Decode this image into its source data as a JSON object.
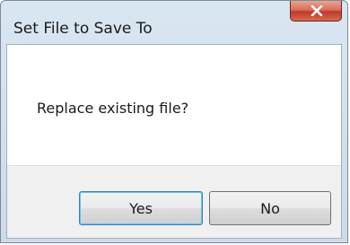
{
  "window": {
    "title": "Set File to Save To"
  },
  "titlebar": {
    "close_icon": "close-x-icon",
    "close_color": "#c0392b"
  },
  "dialog": {
    "message": "Replace existing file?",
    "buttons": {
      "yes_label": "Yes",
      "no_label": "No"
    },
    "default_button": "Yes"
  }
}
